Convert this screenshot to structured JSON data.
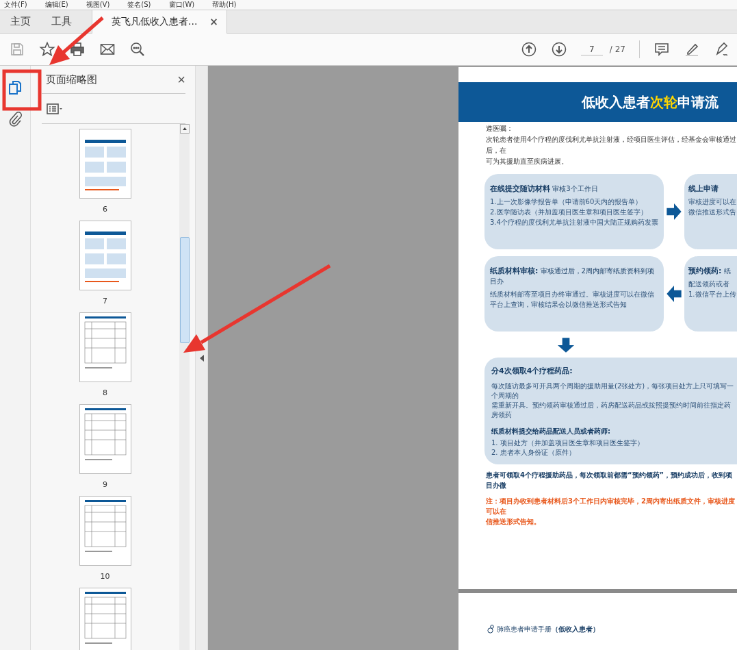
{
  "menu_bar": [
    "文件(F)",
    "编辑(E)",
    "视图(V)",
    "签名(S)",
    "窗口(W)",
    "帮助(H)"
  ],
  "tabs": [
    {
      "label": "主页",
      "selected": false,
      "kind": "nav"
    },
    {
      "label": "工具",
      "selected": false,
      "kind": "nav"
    },
    {
      "label": "英飞凡低收入患者...",
      "selected": true,
      "kind": "document",
      "close": "×"
    }
  ],
  "toolbar": {
    "page_number": "7",
    "page_total": "/ 27"
  },
  "thumbnail_panel": {
    "title": "页面缩略图",
    "close": "×",
    "thumbnails": [
      {
        "label": "6",
        "kind": "boxes"
      },
      {
        "label": "7",
        "kind": "boxes"
      },
      {
        "label": "8",
        "kind": "table"
      },
      {
        "label": "9",
        "kind": "table"
      },
      {
        "label": "10",
        "kind": "table"
      },
      {
        "kind": "table"
      }
    ]
  },
  "document": {
    "title_segments": [
      {
        "text": "低收入患者",
        "highlight": false
      },
      {
        "text": "次轮",
        "highlight": true
      },
      {
        "text": "申请流",
        "highlight": false
      }
    ],
    "intro_lines": [
      "遵医嘱：",
      "次轮患者使用4个疗程的度伐利尤单抗注射液，经项目医生评估，经基金会审核通过后，在",
      "可为其援助直至疾病进展。"
    ],
    "step_rows": [
      {
        "kind": "forward",
        "cards": [
          {
            "title": "在线提交随访材料",
            "subtitle": "审核3个工作日",
            "lines": [
              "1.上一次影像学报告单（申请前60天内的报告单）",
              "2.医学随访表（并加盖项目医生章和项目医生签字）",
              "3.4个疗程的度伐利尤单抗注射液中国大陆正规购药发票"
            ]
          },
          {
            "title": "线上申请",
            "lines": [
              "审核进度可以在",
              "微信推送形式告"
            ]
          }
        ]
      },
      {
        "kind": "backward",
        "cards": [
          {
            "title": "纸质材料审核:",
            "subtitle": "审核通过后，2周内邮寄纸质资料到项目办",
            "lines": [
              "纸质材料邮寄至项目办终审通过。审核进度可以在微信平台上查询，审核结果会以微信推送形式告知"
            ]
          },
          {
            "title": "预约领药:",
            "subtitle": "纸",
            "lines": [
              "配送领药或者",
              "1.微信平台上传"
            ]
          }
        ]
      }
    ],
    "summary_card": {
      "title": "分4次领取4个疗程药品:",
      "paragraph_lines": [
        "每次随访最多可开具两个周期的援助用量(2张处方)，每张项目处方上只可填写一个周期的",
        "需重新开具。预约领药审核通过后，药房配送药品或按照提预约时间前往指定药房领药"
      ],
      "subtitle": "纸质材料提交给药品配送人员或者药师:",
      "items": [
        "1. 项目处方（并加盖项目医生章和项目医生签字）",
        "2. 患者本人身份证（原件）"
      ]
    },
    "notes": [
      {
        "kind": "info",
        "lines": [
          "患者可领取4个疗程援助药品，每次领取前都需“预约领药”，预约成功后，收到项目办微"
        ]
      },
      {
        "kind": "warning",
        "lines": [
          "注：项目办收到患者材料后3个工作日内审核完毕，2周内寄出纸质文件，审核进度可以在",
          "信推送形式告知。"
        ]
      }
    ],
    "footer": "肺癌患者申请手册**（低收入患者）**"
  }
}
